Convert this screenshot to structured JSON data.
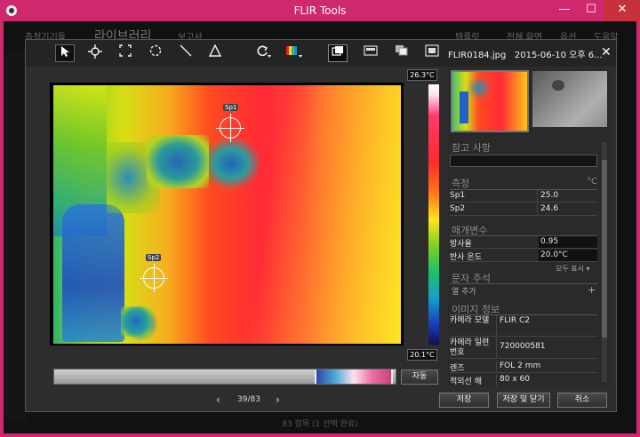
{
  "window": {
    "title": "FLIR Tools",
    "minimize": "—",
    "maximize": "☐",
    "close": "✕"
  },
  "background_app": {
    "nav": [
      "측정기기들",
      "라이브러리",
      "보고서",
      "템플릿",
      "전체 화면",
      "옵션",
      "도움말"
    ],
    "status": "83 항목 (1 선택 완료)"
  },
  "dialog": {
    "filename": "FLIR0184.jpg",
    "date": "2015-06-10 오후 6...",
    "close": "✕",
    "tools": [
      "select-arrow-icon",
      "spot-tool-icon",
      "box-tool-icon",
      "circle-tool-icon",
      "line-tool-icon",
      "delta-tool-icon",
      "rotate-icon",
      "palette-icon",
      "view-ir-icon",
      "view-photo-icon",
      "view-overlay-icon",
      "view-pip-icon"
    ]
  },
  "image": {
    "scale_max": "26.3°C",
    "scale_min": "20.1°C",
    "spots": [
      {
        "label": "Sp1"
      },
      {
        "label": "Sp2"
      }
    ]
  },
  "bottom": {
    "auto_button": "자동",
    "prev": "‹",
    "next": "›",
    "pager": "39/83",
    "save": "저장",
    "save_close": "저장 및 닫기",
    "cancel": "취소"
  },
  "panel": {
    "notes": {
      "title": "참고 사항"
    },
    "measurements": {
      "title": "측정",
      "unit": "°C",
      "rows": [
        {
          "name": "Sp1",
          "value": "25.0"
        },
        {
          "name": "Sp2",
          "value": "24.6"
        }
      ]
    },
    "parameters": {
      "title": "매개변수",
      "rows": [
        {
          "name": "방사율",
          "value": "0.95"
        },
        {
          "name": "반사 온도",
          "value": "20.0°C"
        }
      ],
      "show_all": "모두 표시 ▾"
    },
    "text_annotation": {
      "title": "문자 주석",
      "add_label": "열 추가",
      "add_icon": "+"
    },
    "image_info": {
      "title": "이미지 정보",
      "rows": [
        {
          "name": "카메라 모델",
          "value": "FLIR C2"
        },
        {
          "name": "카메라 일련 번호",
          "value": "720000581"
        },
        {
          "name": "렌즈",
          "value": "FOL 2 mm"
        },
        {
          "name": "적외선 해",
          "value": "80 x 60"
        }
      ]
    }
  }
}
